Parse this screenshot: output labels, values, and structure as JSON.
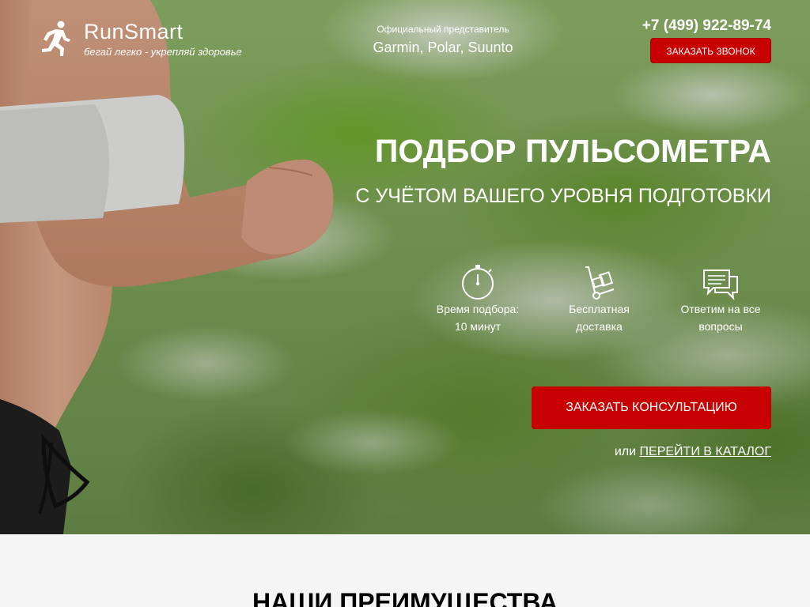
{
  "header": {
    "logo_name": "RunSmart",
    "logo_tagline": "бегай легко - укрепляй здоровье",
    "dealer_label": "Официальный представитель",
    "dealer_brands": "Garmin, Polar, Suunto",
    "phone": "+7 (499) 922-89-74",
    "call_button": "ЗАКАЗАТЬ ЗВОНОК"
  },
  "hero": {
    "title": "ПОДБОР ПУЛЬСОМЕТРА",
    "subtitle": "С УЧЁТОМ ВАШЕГО УРОВНЯ ПОДГОТОВКИ",
    "features": [
      {
        "icon": "stopwatch-icon",
        "line1": "Время подбора:",
        "line2": "10 минут"
      },
      {
        "icon": "hand-truck-icon",
        "line1": "Бесплатная",
        "line2": "доставка"
      },
      {
        "icon": "chat-icon",
        "line1": "Ответим на все",
        "line2": "вопросы"
      }
    ],
    "consult_button": "ЗАКАЗАТЬ КОНСУЛЬТАЦИЮ",
    "catalog_prefix": "или",
    "catalog_link": "ПЕРЕЙТИ В КАТАЛОГ"
  },
  "advantages": {
    "title": "НАШИ ПРЕИМУЩЕСТВА"
  },
  "colors": {
    "accent": "#c70101",
    "text_light": "#ffffff",
    "section_bg": "#f5f5f5"
  }
}
